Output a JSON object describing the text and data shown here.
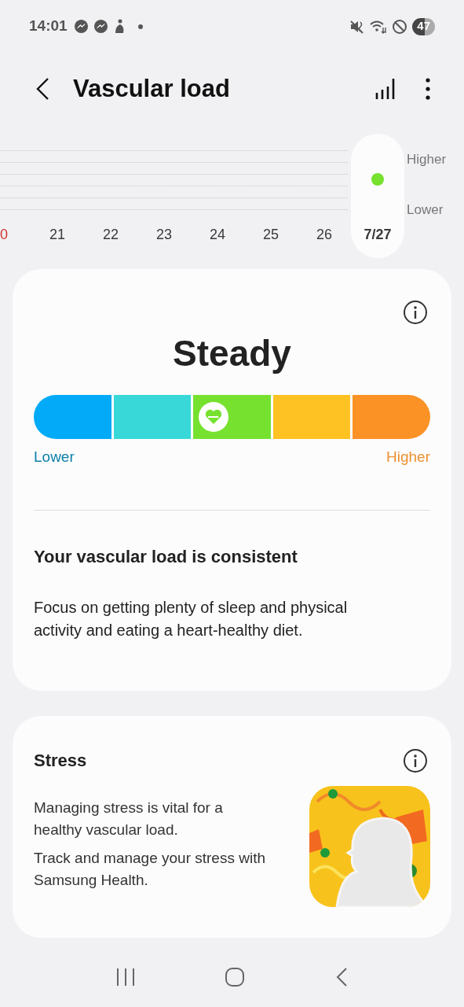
{
  "status_bar": {
    "time": "14:01",
    "battery": "47"
  },
  "header": {
    "title": "Vascular load"
  },
  "trend": {
    "axis_labels": [
      "Higher",
      "Lower"
    ],
    "days": [
      {
        "label": "0",
        "color": "#d0342c",
        "selected": false
      },
      {
        "label": "21",
        "color": "#3a3a3a",
        "selected": false
      },
      {
        "label": "22",
        "color": "#3a3a3a",
        "selected": false
      },
      {
        "label": "23",
        "color": "#3a3a3a",
        "selected": false
      },
      {
        "label": "24",
        "color": "#3a3a3a",
        "selected": false
      },
      {
        "label": "25",
        "color": "#3a3a3a",
        "selected": false
      },
      {
        "label": "26",
        "color": "#3a3a3a",
        "selected": false
      },
      {
        "label": "7/27",
        "color": "#3a3a3a",
        "selected": true
      }
    ]
  },
  "result": {
    "status": "Steady",
    "scale": [
      {
        "color": "#02aaf8",
        "selected": false
      },
      {
        "color": "#38d8d8",
        "selected": false
      },
      {
        "color": "#76e12f",
        "selected": true
      },
      {
        "color": "#fec323",
        "selected": false
      },
      {
        "color": "#fb9225",
        "selected": false
      }
    ],
    "low_label": "Lower",
    "high_label": "Higher",
    "heading": "Your vascular load is consistent",
    "body": "Focus on getting plenty of sleep and physical activity and eating a heart-healthy diet."
  },
  "stress": {
    "title": "Stress",
    "paragraphs": [
      "Managing stress is vital for a healthy vascular load.",
      "Track and manage your stress with Samsung Health."
    ]
  }
}
